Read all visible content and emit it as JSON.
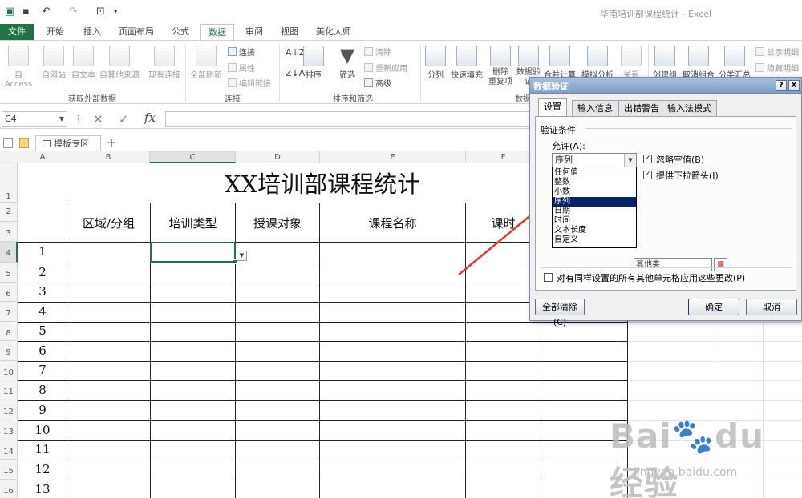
{
  "window": {
    "title": "华南培训部课程统计 - Excel"
  },
  "quick_access": {
    "save": "💾",
    "undo": "↶",
    "redo": "↷",
    "preview": "🔍",
    "more": "▾"
  },
  "tabs": [
    "文件",
    "开始",
    "插入",
    "页面布局",
    "公式",
    "数据",
    "审阅",
    "视图",
    "美化大师"
  ],
  "ribbon": {
    "from_access": "自 Access",
    "from_web": "自网站",
    "from_text": "自文本",
    "from_other": "自其他来源",
    "existing": "现有连接",
    "refresh_all": "全部刷新",
    "connections": "连接",
    "properties": "属性",
    "edit_links": "编辑链接",
    "sort": "排序",
    "filter": "筛选",
    "clear": "清除",
    "reapply": "重新应用",
    "advanced": "高级",
    "text_to_col": "分列",
    "flash_fill": "快速填充",
    "remove_dup_1": "删除",
    "remove_dup_2": "重复项",
    "data_valid_1": "数据验",
    "data_valid_2": "证",
    "consolidate": "合并计算",
    "whatif": "模拟分析",
    "relations": "关系",
    "group": "创建组",
    "ungroup": "取消组合",
    "subtotal": "分类汇总",
    "show_detail": "显示明细",
    "hide_detail": "隐藏明细",
    "grp_external": "获取外部数据",
    "grp_connections": "连接",
    "grp_sortfilter": "排序和筛选",
    "grp_data": "数据"
  },
  "formula_bar": {
    "name_box": "C4",
    "fx": "fx",
    "cancel": "✕",
    "enter": "✓"
  },
  "sheet_tabs": {
    "template": "模板专区",
    "add": "+"
  },
  "columns": [
    "A",
    "B",
    "C",
    "D",
    "E",
    "F"
  ],
  "rows": [
    "1",
    "2",
    "3",
    "4",
    "5",
    "6",
    "7",
    "8",
    "9",
    "10",
    "11",
    "12",
    "13",
    "14",
    "15",
    "16"
  ],
  "sheet": {
    "title": "XX培训部课程统计",
    "headers": [
      "区域/分组",
      "培训类型",
      "授课对象",
      "课程名称",
      "课时"
    ],
    "numbers": [
      "1",
      "2",
      "3",
      "4",
      "5",
      "6",
      "7",
      "8",
      "9",
      "10",
      "11",
      "12",
      "13"
    ]
  },
  "dialog": {
    "title": "数据验证",
    "help": "?",
    "close": "X",
    "tabs": [
      "设置",
      "输入信息",
      "出错警告",
      "输入法模式"
    ],
    "section": "验证条件",
    "allow_label": "允许(A):",
    "allow_value": "序列",
    "options": [
      "任何值",
      "整数",
      "小数",
      "序列",
      "日期",
      "时间",
      "文本长度",
      "自定义"
    ],
    "ignore_blank": "忽略空值(B)",
    "dropdown": "提供下拉箭头(I)",
    "source_value": "其他类",
    "apply_all": "对有同样设置的所有其他单元格应用这些更改(P)",
    "clear_all": "全部清除(C)",
    "ok": "确定",
    "cancel": "取消"
  },
  "watermark": {
    "logo": "Bai du 经验",
    "url": "jingyan.baidu.com"
  }
}
